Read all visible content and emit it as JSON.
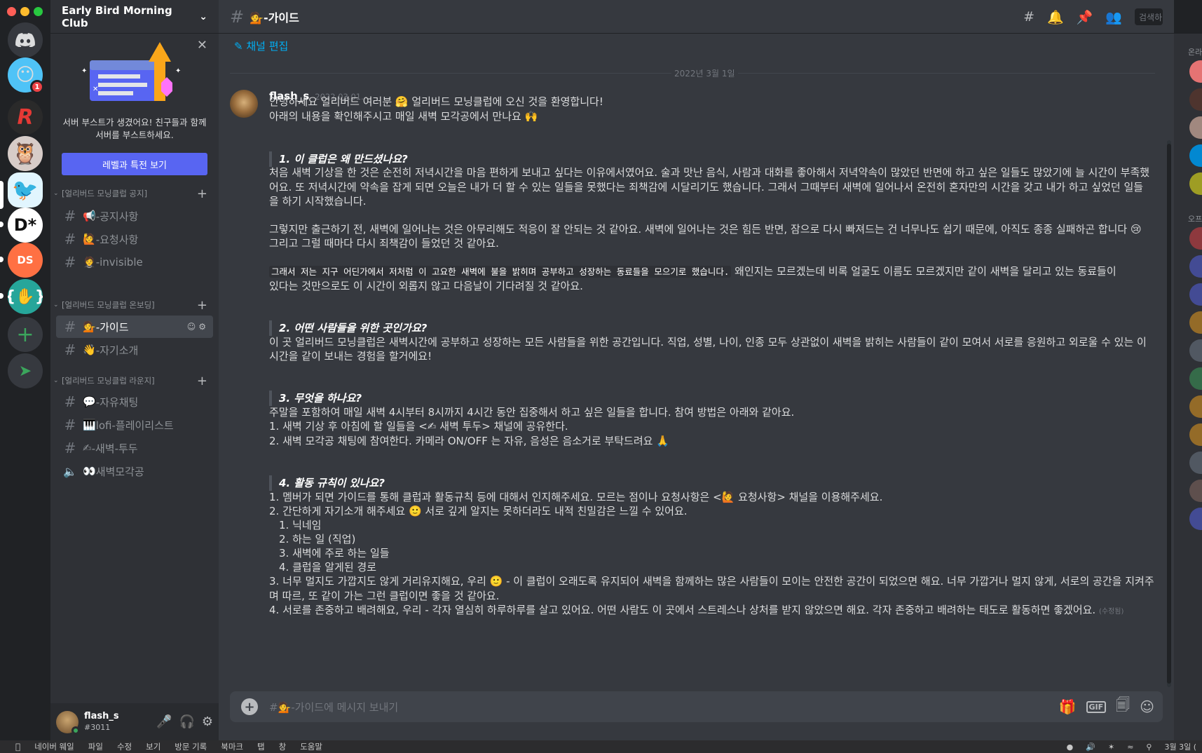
{
  "window": {
    "traffic_lights": [
      "#ff5f57",
      "#febc2e",
      "#28c840"
    ]
  },
  "servers": [
    {
      "name": "home",
      "icon": "discord-icon"
    },
    {
      "name": "server-2",
      "icon": "smiley-icon",
      "badge": "1"
    },
    {
      "name": "server-3",
      "icon": "r-logo",
      "label": "R"
    },
    {
      "name": "server-4",
      "icon": "owl-icon"
    },
    {
      "name": "server-5",
      "icon": "bird-icon"
    },
    {
      "name": "server-6",
      "icon": "d-logo",
      "label": "D*"
    },
    {
      "name": "server-7",
      "icon": "ds-logo",
      "label": "DS"
    },
    {
      "name": "server-8",
      "icon": "code-icon"
    }
  ],
  "sidebar": {
    "server_name": "Early Bird Morning Club",
    "boost_text": "서버 부스트가 생겼어요! 친구들과 함께 서버를 부스트하세요.",
    "boost_button": "레벨과 특전 보기",
    "categories": [
      {
        "name": "[얼리버드 모닝클럽 공지]",
        "channels": [
          {
            "emoji": "📢",
            "name": "-공지사항"
          },
          {
            "emoji": "🙋",
            "name": "-요청사항"
          },
          {
            "emoji": "🤵",
            "name": "-invisible"
          }
        ]
      },
      {
        "name": "[얼리버드 모닝클럽 온보딩]",
        "channels": [
          {
            "emoji": "💁",
            "name": "-가이드"
          },
          {
            "emoji": "👋",
            "name": "-자기소개"
          }
        ]
      },
      {
        "name": "[얼리버드 모닝클럽 라운지]",
        "channels": [
          {
            "emoji": "💬",
            "name": "-자유채팅"
          },
          {
            "emoji": "🎹",
            "name": "lofi-플레이리스트"
          },
          {
            "emoji": "✍",
            "name": "-새벽-투두"
          },
          {
            "emoji": "👀",
            "name": "새벽모각공",
            "voice": true
          }
        ]
      }
    ]
  },
  "user": {
    "name": "flash_s",
    "tag": "#3011"
  },
  "channel": {
    "name": "💁-가이드",
    "edit_link": "채널 편집",
    "date_divider": "2022년 3월 1일"
  },
  "message": {
    "author": "flash_s",
    "timestamp": "2022.03.01.",
    "lines": [
      "안녕하세요 얼리버드 여러분 🤗 얼리버드 모닝클럽에 오신 것을 환영합니다!",
      "아래의 내용을 확인해주시고 매일 새벽 모각공에서 만나요 🙌",
      "1. 이 클럽은 왜 만드셨나요?",
      "처음 새벽 기상을 한 것은 순전히 저녁시간을 마음 편하게 보내고 싶다는 이유에서였어요. 술과 맛난 음식, 사람과 대화를 좋아해서 저녁약속이 많았던 반면에 하고 싶은 일들도 많았기에 늘 시간이 부족했",
      "어요. 또 저녁시간에 약속을 잡게 되면 오늘은 내가 더 할 수 있는 일들을 못했다는 죄책감에 시달리기도 했습니다. 그래서 그때부터 새벽에 일어나서 온전히 혼자만의 시간을 갖고 내가 하고 싶었던 일들",
      "을 하기 시작했습니다.",
      "그렇지만 출근하기 전, 새벽에 일어나는 것은 아무리해도 적응이 잘 안되는 것 같아요. 새벽에 일어나는 것은 힘든 반면, 잠으로 다시 빠져드는 건 너무나도 쉽기 때문에, 아직도 종종 실패하곤 합니다 😢",
      "그리고 그럴 때마다 다시 죄책감이 들었던 것 같아요.",
      "그래서 저는 지구 어딘가에서 저처럼 이 고요한 새벽에 불을 밝히며 공부하고 성장하는 동료들을 모으기로 했습니다.",
      " 왜인지는 모르겠는데 비록 얼굴도 이름도 모르겠지만 같이 새벽을 달리고 있는 동료들이",
      "있다는 것만으로도 이 시간이 외롭지 않고 다음날이 기다려질 것 같아요.",
      "2. 어떤 사람들을 위한 곳인가요?",
      "이 곳 얼리버드 모닝클럽은 새벽시간에 공부하고 성장하는 모든 사람들을 위한 공간입니다. 직업, 성별, 나이, 인종 모두 상관없이 새벽을 밝히는 사람들이 같이 모여서 서로를 응원하고 외로울 수 있는 이",
      "시간을 같이 보내는 경험을 할거에요!",
      "3. 무엇을 하나요?",
      "주말을 포함하여 매일 새벽 4시부터 8시까지 4시간 동안 집중해서 하고 싶은 일들을 합니다. 참여 방법은 아래와 같아요.",
      "1. 새벽 기상 후 아침에 할 일들을 <✍ 새벽 투두> 채널에 공유한다.",
      "2. 새벽 모각공 채팅에 참여한다. 카메라 ON/OFF 는 자유, 음성은 음소거로 부탁드려요 🙏",
      "4. 활동 규칙이 있나요?",
      "1. 멤버가 되면 가이드를 통해 클럽과 활동규칙 등에 대해서 인지해주세요. 모르는 점이나 요청사항은 <🙋 요청사항> 채널을 이용해주세요.",
      "2. 간단하게 자기소개 해주세요 🙂 서로 깊게 알지는 못하더라도 내적 친밀감은 느낄 수 있어요.",
      "1. 닉네임",
      "2. 하는 일 (직업)",
      "3. 새벽에 주로 하는 일들",
      "4. 클럽을 알게된 경로",
      "3. 너무 멀지도 가깝지도 않게 거리유지해요, 우리 🙂 - 이 클럽이 오래도록 유지되어 새벽을 함께하는 많은 사람들이 모이는 안전한 공간이 되었으면 해요. 너무 가깝거나 멀지 않게, 서로의 공간을 지켜주",
      "며 따르, 또 같이 가는 그런 클럽이면 좋을 것 같아요.",
      "4. 서로를 존중하고 배려해요, 우리 - 각자 열심히 하루하루를 살고 있어요. 어떤 사람도 이 곳에서 스트레스나 상처를 받지 않았으면 해요. 각자 존중하고 배려하는 태도로 활동하면 좋겠어요."
    ],
    "edited": "(수정됨)"
  },
  "composer": {
    "placeholder": "#💁-가이드에 메시지 보내기"
  },
  "header": {
    "search": "검색하"
  },
  "members": {
    "online_head": "온라",
    "offline_head": "오프"
  },
  "menubar": {
    "items": [
      "네이버 웨일",
      "파일",
      "수정",
      "보기",
      "방문 기록",
      "북마크",
      "탭",
      "창",
      "도움말"
    ],
    "clock": "3월 3일 ("
  }
}
